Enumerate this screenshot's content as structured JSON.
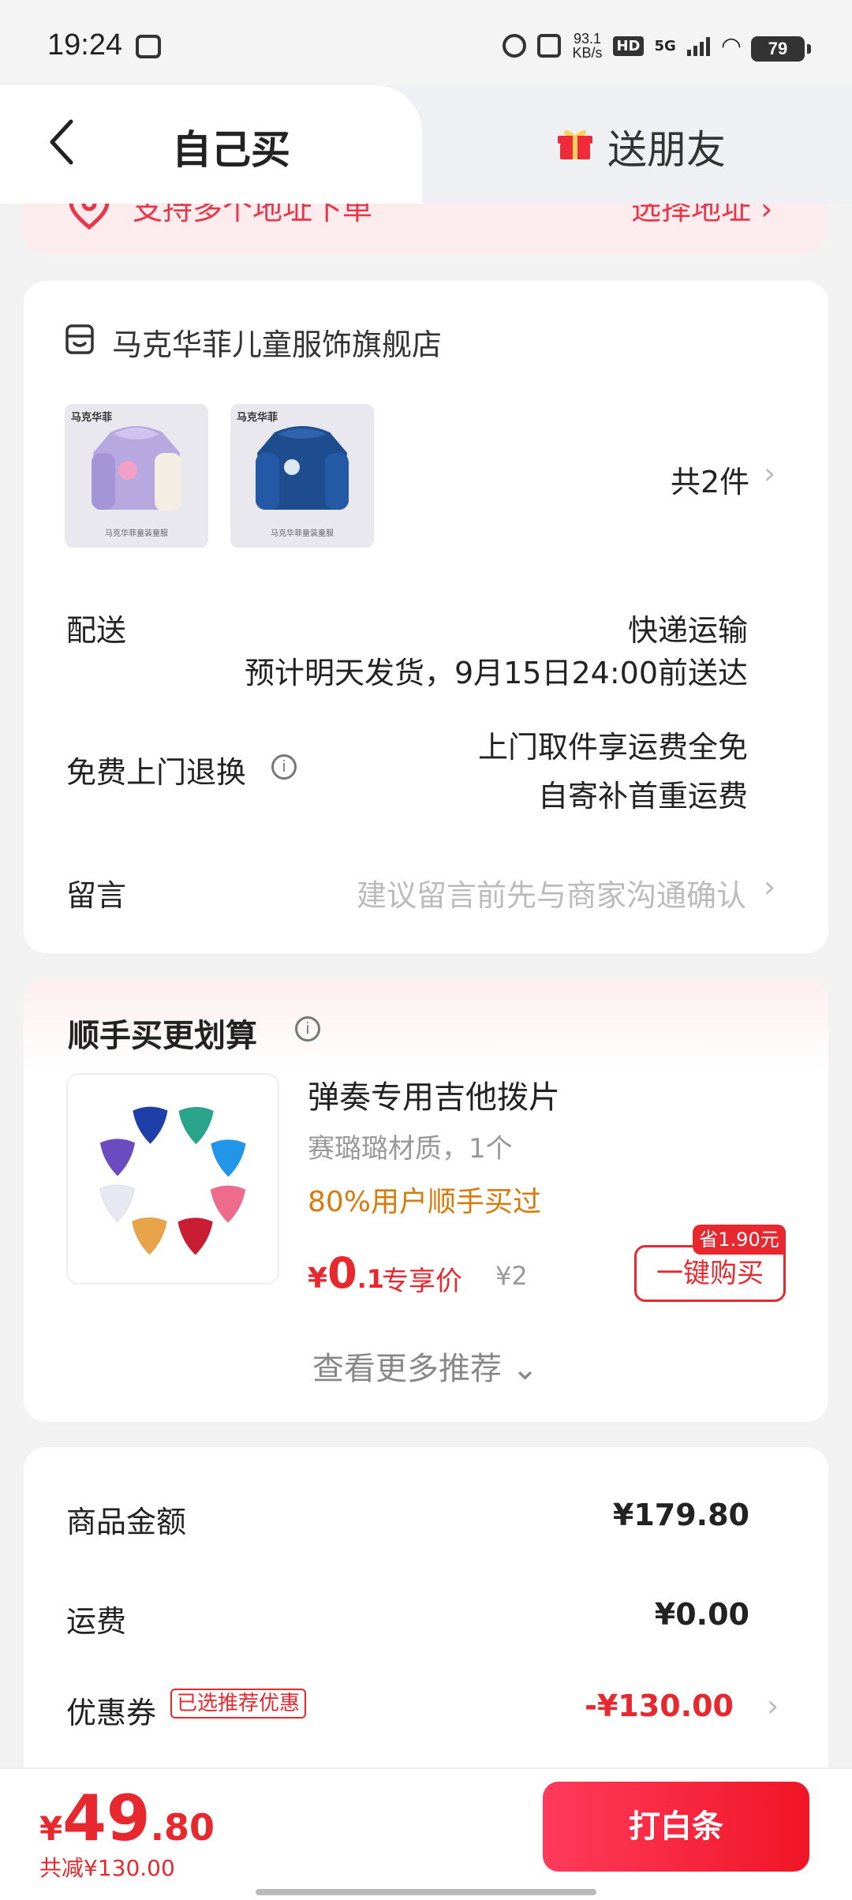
{
  "status_bar": {
    "time": "19:24",
    "net_speed_top": "93.1",
    "net_speed_bottom": "KB/s",
    "hd": "HD",
    "network": "5G",
    "battery": "79",
    "icons": [
      "message-icon",
      "alarm-icon",
      "mute-icon",
      "signal-icon",
      "wifi-icon",
      "battery-icon"
    ]
  },
  "tabs": {
    "self_label": "自己买",
    "friend_label": "送朋友",
    "back_icon": "chevron-left-icon",
    "gift_icon": "gift-icon"
  },
  "address_strip": {
    "text": "支持多个地址下单",
    "button": "选择地址 ›"
  },
  "order": {
    "store_name": "马克华菲儿童服饰旗舰店",
    "products": [
      {
        "brand": "马克华菲",
        "caption": "马克华菲童装童服"
      },
      {
        "brand": "马克华菲",
        "caption": "马克华菲童装童服"
      }
    ],
    "count": "共2件",
    "shipping": {
      "label": "配送",
      "method": "快递运输",
      "eta": "预计明天发货，9月15日24:00前送达"
    },
    "returns": {
      "label": "免费上门退换",
      "line1": "上门取件享运费全免",
      "line2": "自寄补首重运费"
    },
    "message": {
      "label": "留言",
      "placeholder": "建议留言前先与商家沟通确认"
    }
  },
  "addon": {
    "title": "顺手买更划算",
    "product_name": "弹奏专用吉他拨片",
    "spec": "赛璐璐材质，1个",
    "tag": "80%用户顺手买过",
    "price_yen": "¥",
    "price_int": "0",
    "price_dec": ".1",
    "price_label": "专享价",
    "original_price": "¥2",
    "save_badge": "省1.90元",
    "buy_button": "一键购买",
    "more": "查看更多推荐 ⌄",
    "pick_colors": [
      "#2aa58b",
      "#2196e8",
      "#ef6b8e",
      "#c81d33",
      "#e9a44a",
      "#e6e8f2",
      "#6b4bc0",
      "#1e3fa8"
    ]
  },
  "summary": {
    "amount_label": "商品金额",
    "amount_value": "¥179.80",
    "freight_label": "运费",
    "freight_value": "¥0.00",
    "coupon_label": "优惠券",
    "coupon_badge": "已选推荐优惠",
    "coupon_value": "-¥130.00"
  },
  "bottom": {
    "total_yen": "¥",
    "total_int": "49",
    "total_dec": ".80",
    "saved": "共减¥130.00",
    "pay_button": "打白条"
  },
  "colors": {
    "accent": "#e8282f",
    "tag_orange": "#d97a0c",
    "pay_gradient": [
      "#ff3b5c",
      "#f01526"
    ]
  }
}
